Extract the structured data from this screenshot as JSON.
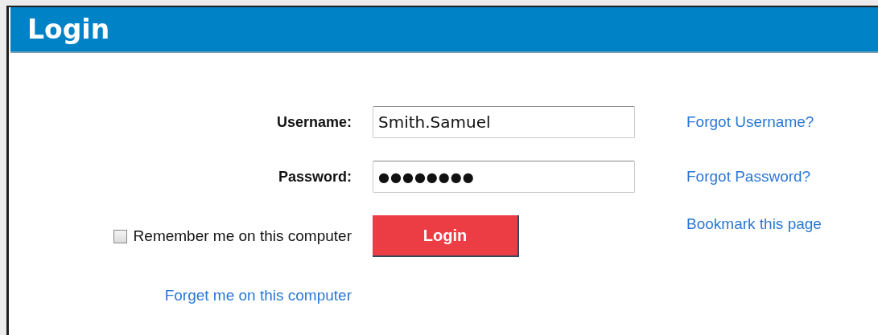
{
  "header": {
    "title": "Login"
  },
  "form": {
    "username": {
      "label": "Username:",
      "value": "Smith.Samuel",
      "link": "Forgot Username?"
    },
    "password": {
      "label": "Password:",
      "value": "●●●●●●●●",
      "link": "Forgot Password?"
    },
    "remember": {
      "label": "Remember me on this computer",
      "checked": false
    },
    "login_button": "Login",
    "bookmark_link": "Bookmark this page",
    "forget_link": "Forget me on this computer"
  }
}
